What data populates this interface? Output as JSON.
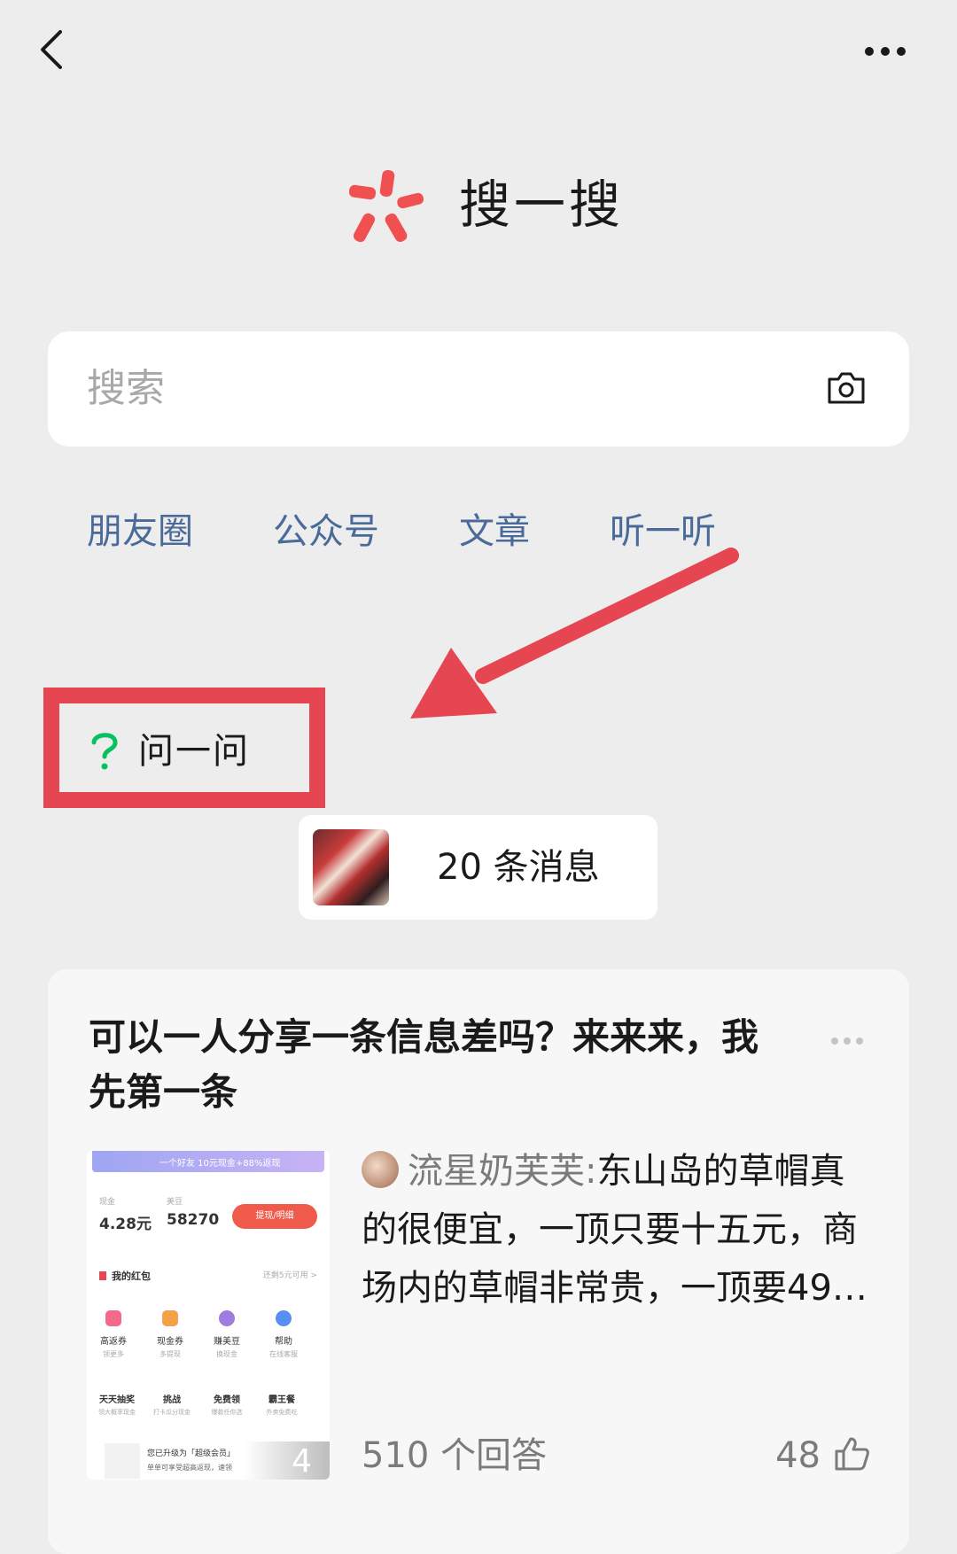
{
  "header": {
    "title": "搜一搜"
  },
  "search": {
    "placeholder": "搜索"
  },
  "categories": [
    "朋友圈",
    "公众号",
    "文章",
    "听一听"
  ],
  "ask": {
    "label": "问一问"
  },
  "messages": {
    "label": "20 条消息"
  },
  "question": {
    "title": "可以一人分享一条信息差吗？来来来，我先第一条",
    "answer_author": "流星奶芙芙:",
    "answer_text": "东山岛的草帽真的很便宜，一顶只要十五元，商场内的草帽非常贵，一顶要49…",
    "answers_count": "510 个回答",
    "likes": "48",
    "image_count": "4",
    "screenshot": {
      "banner": "一个好友 10元现金+88%返现",
      "cash_label": "现金",
      "cash_value": "4.28元",
      "beans_label": "美豆",
      "beans_value": "58270",
      "withdraw_button": "提现/明细",
      "redpacket_label": "我的红包",
      "redpacket_right": "还剩5元可用 >",
      "icons": [
        {
          "label": "高返券",
          "sub": "领更多"
        },
        {
          "label": "现金券",
          "sub": "多提现"
        },
        {
          "label": "赚美豆",
          "sub": "换现金"
        },
        {
          "label": "帮助",
          "sub": "在线客服"
        }
      ],
      "games": [
        {
          "label": "天天抽奖",
          "sub": "领大概率现金"
        },
        {
          "label": "挑战",
          "sub": "打卡瓜分现金"
        },
        {
          "label": "免费领",
          "sub": "爆款任你选"
        },
        {
          "label": "霸王餐",
          "sub": "外卖免费吃"
        }
      ],
      "upgrade_text": "您已升级为「超级会员」",
      "upgrade_sub": "单单可享受超高返现，速领"
    }
  },
  "colors": {
    "accent_red": "#e64552",
    "link_blue": "#4a6b9a",
    "ask_green": "#07c160",
    "background": "#ededed"
  }
}
